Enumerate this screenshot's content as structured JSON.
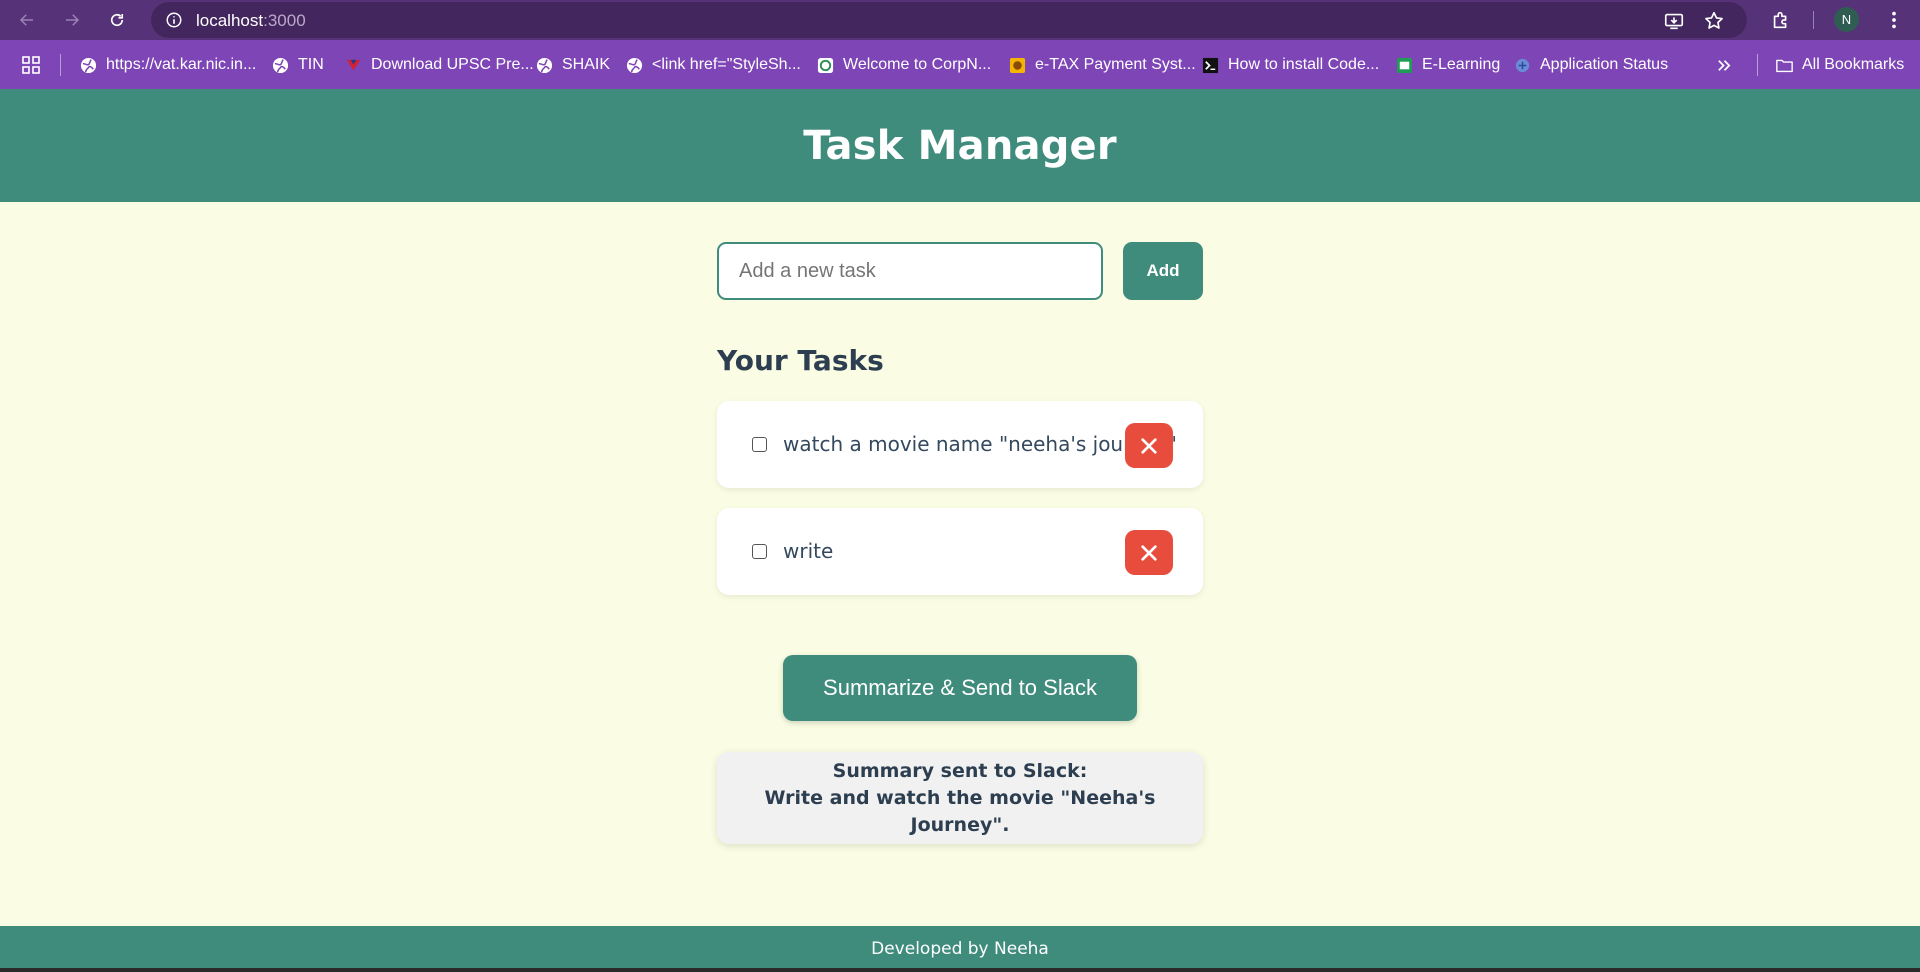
{
  "browser": {
    "url_host": "localhost",
    "url_port": ":3000",
    "profile_initial": "N",
    "bookmarks": [
      {
        "label": "https://vat.kar.nic.in...",
        "icon": "globe-icon"
      },
      {
        "label": "TIN",
        "icon": "globe-icon"
      },
      {
        "label": "Download UPSC Pre...",
        "icon": "flag-icon"
      },
      {
        "label": "SHAIK",
        "icon": "globe-icon"
      },
      {
        "label": "<link href=\"StyleSh...",
        "icon": "globe-icon"
      },
      {
        "label": "Welcome to CorpN...",
        "icon": "site-icon"
      },
      {
        "label": "e-TAX Payment Syst...",
        "icon": "site-icon"
      },
      {
        "label": "How to install Code...",
        "icon": "terminal-icon"
      },
      {
        "label": "E-Learning",
        "icon": "site-icon"
      },
      {
        "label": "Application Status",
        "icon": "site-icon"
      }
    ],
    "all_bookmarks_label": "All Bookmarks"
  },
  "app": {
    "title": "Task Manager",
    "input_placeholder": "Add a new task",
    "add_label": "Add",
    "section_title": "Your Tasks",
    "tasks": [
      {
        "text": "watch a movie name \"neeha's journey\"",
        "checked": false
      },
      {
        "text": "write",
        "checked": false
      }
    ],
    "summarize_label": "Summarize & Send to Slack",
    "summary_heading": "Summary sent to Slack:",
    "summary_text": "Write and watch the movie \"Neeha's Journey\".",
    "footer": "Developed by Neeha"
  },
  "colors": {
    "primary": "#3f8c7d",
    "background": "#fafde3",
    "danger": "#e74c3c",
    "chrome": "#563278",
    "bookmarks_bar": "#7d45b5"
  }
}
